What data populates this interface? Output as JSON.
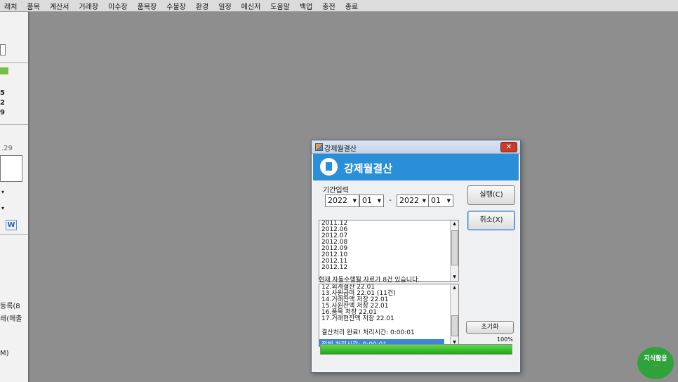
{
  "menubar": {
    "items": [
      "래처",
      "품목",
      "계산서",
      "거래장",
      "미수장",
      "품목장",
      "수불장",
      "환경",
      "일정",
      "메신저",
      "도움말",
      "백업",
      "충전",
      "종료"
    ]
  },
  "left_panel": {
    "digits": [
      "5",
      "2",
      "9"
    ],
    "date_fragment": ".29",
    "w_icon": "W",
    "text1": "등록(8",
    "text2": "쇄(매출",
    "text3": "M)"
  },
  "dialog": {
    "title": "강제월결산",
    "banner_title": "강제월결산",
    "period_label": "기간입력",
    "from_year": "2022",
    "from_month": "01",
    "separator": "-",
    "to_year": "2022",
    "to_month": "01",
    "execute_button": "실행(C)",
    "cancel_button": "취소(X)",
    "month_list": [
      "2011.12",
      "2012.06",
      "2012.07",
      "2012.08",
      "2012.09",
      "2012.10",
      "2012.11",
      "2012.12"
    ],
    "status_text": "현재 자동수행될 자료가 8건 있습니다.",
    "log_lines": [
      "12.회계결산 22.01",
      "13.사원급여 22.01 (11건)",
      "14.거래잔액 저장 22.01",
      "15.사원잔액 저장 22.01",
      "16.품목 저장 22.01",
      "17.거래현잔액 저장 22.01"
    ],
    "done_text": "결산처리 완료!  처리시간: 0:00:01",
    "selected_line": "전체 처리시간: 0:00:01",
    "reset_button": "초기화",
    "progress_percent": "100%",
    "progress_value": 100
  },
  "colors": {
    "banner": "#2a8fd8",
    "progress": "#22a518",
    "close": "#c83b2b"
  }
}
